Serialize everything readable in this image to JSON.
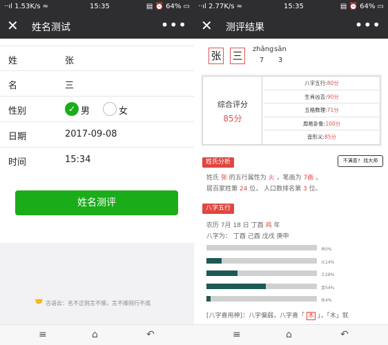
{
  "left": {
    "status": {
      "signal": "··ıl 1.53K/s ≈",
      "time": "15:35",
      "right": "▤ ⏰ 64% ▭"
    },
    "title": "姓名测试",
    "close_icon": "✕",
    "more_icon": "•••",
    "form": {
      "surname_label": "姓",
      "surname_value": "张",
      "name_label": "名",
      "name_value": "三",
      "gender_label": "性别",
      "gender_options": [
        "男",
        "女"
      ],
      "gender_selected": "男",
      "date_label": "日期",
      "date_value": "2017-09-08",
      "time_label": "时间",
      "time_value": "15:34"
    },
    "submit_label": "姓名测评",
    "footer_note": "古语云：名不正则言不顺，言不顺则行不成",
    "footer_icon": "handshake-icon"
  },
  "right": {
    "status": {
      "signal": "··ıl 2.77K/s ≈",
      "time": "15:35",
      "right": "▤ ⏰ 64% ▭"
    },
    "title": "测评结果",
    "close_icon": "✕",
    "more_icon": "•••",
    "name_chars": [
      "张",
      "三"
    ],
    "pinyin": [
      "zhāng",
      "sān"
    ],
    "strokes": [
      "7",
      "3"
    ],
    "overall": {
      "label": "综合评分",
      "value": "85分"
    },
    "scores": [
      {
        "label": "八字五行:",
        "value": "80分"
      },
      {
        "label": "生肖凶吉:",
        "value": "90分"
      },
      {
        "label": "五格数理:",
        "value": "71分"
      },
      {
        "label": "周易卦象:",
        "value": "100分"
      },
      {
        "label": "音形义:",
        "value": "85分"
      }
    ],
    "surname_section": {
      "tag": "姓氏分析",
      "expert_button": "不满意? 找大师",
      "line1": {
        "a": "姓氏",
        "surname": "张",
        "b": "的五行属性为",
        "element": "火",
        "c": "，笔画为",
        "strokes": "7画",
        "d": "。"
      },
      "line2": {
        "a": "居百家姓第",
        "rank": "24",
        "b": "位， 人口数排名第",
        "pop": "3",
        "c": "位。"
      }
    },
    "bazi_section": {
      "tag": "八字五行",
      "lunar": {
        "a": "农历 7月 18 日 丁酉",
        "zodiac": "鸡",
        "b": "年"
      },
      "bazi_line": "八字为： 丁酉 己酉 戊戌 庚申",
      "bars": [
        {
          "label": "木0%",
          "value": 0
        },
        {
          "label": "火14%",
          "value": 14
        },
        {
          "label": "土28%",
          "value": 28
        },
        {
          "label": "金54%",
          "value": 54
        },
        {
          "label": "水4%",
          "value": 4
        }
      ],
      "analysis": {
        "a": "[八字喜用神]：八字偏弱，八字喜「",
        "wood": "木",
        "b": "」，「木」就"
      }
    }
  },
  "nav": {
    "menu_icon": "≡",
    "home_icon": "⌂",
    "back_icon": "↶"
  }
}
